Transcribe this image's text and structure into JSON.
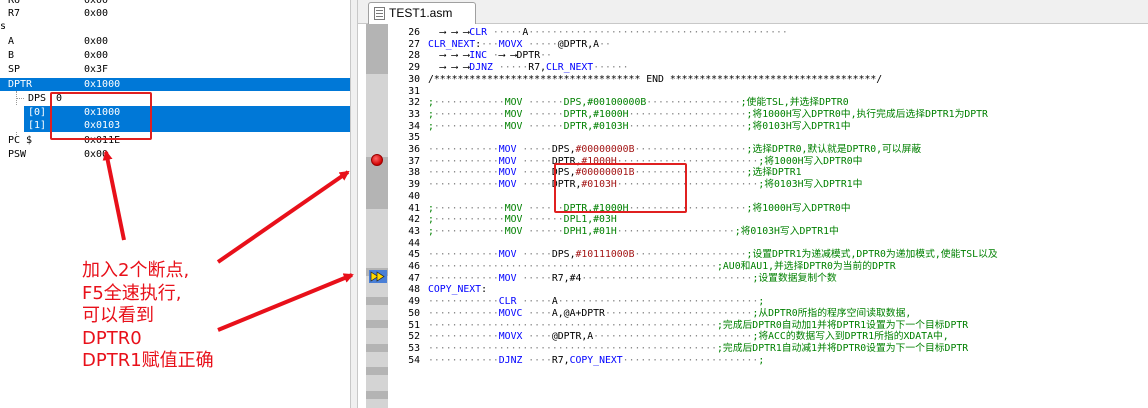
{
  "registers": [
    {
      "name": "R6",
      "value": "0x00"
    },
    {
      "name": "R7",
      "value": "0x00"
    },
    {
      "name": "s",
      "value": ""
    },
    {
      "name": "A",
      "value": "0x00"
    },
    {
      "name": "B",
      "value": "0x00"
    },
    {
      "name": "SP",
      "value": "0x3F"
    },
    {
      "name": "DPTR",
      "value": "0x1000"
    },
    {
      "name": "DPS",
      "value": "0"
    },
    {
      "name": "[0]",
      "value": "0x1000"
    },
    {
      "name": "[1]",
      "value": "0x0103"
    },
    {
      "name": "PC $",
      "value": "0x011E"
    },
    {
      "name": "PSW",
      "value": "0x00"
    }
  ],
  "editor": {
    "tab_title": "TEST1.asm",
    "lines": [
      {
        "n": "26",
        "code": "  ⟶ ⟶ ⟶CLR ·····A············································"
      },
      {
        "n": "27",
        "code": "CLR_NEXT:···MOVX ·····@DPTR,A··"
      },
      {
        "n": "28",
        "code": "  ⟶ ⟶ ⟶INC ·⟶ ⟶DPTR··"
      },
      {
        "n": "29",
        "code": "  ⟶ ⟶ ⟶DJNZ ·····R7,CLR_NEXT······"
      },
      {
        "n": "30",
        "code": "/*********************************** END ***********************************/"
      },
      {
        "n": "31",
        "code": ""
      },
      {
        "n": "32",
        "code": ";············MOV ······DPS,#00100000B················;使能TSL,并选择DPTR0"
      },
      {
        "n": "33",
        "code": ";············MOV ······DPTR,#1000H····················;将1000H写入DPTR0中,执行完成后选择DPTR1为DPTR"
      },
      {
        "n": "34",
        "code": ";············MOV ······DPTR,#0103H····················;将0103H写入DPTR1中"
      },
      {
        "n": "35",
        "code": ""
      },
      {
        "n": "36",
        "code": "············MOV ·····DPS,#00000000B···················;选择DPTR0,默认就是DPTR0,可以屏蔽"
      },
      {
        "n": "37",
        "code": "············MOV ·····DPTR,#1000H························;将1000H写入DPTR0中"
      },
      {
        "n": "38",
        "code": "············MOV ·····DPS,#00000001B···················;选择DPTR1"
      },
      {
        "n": "39",
        "code": "············MOV ·····DPTR,#0103H························;将0103H写入DPTR1中"
      },
      {
        "n": "40",
        "code": ""
      },
      {
        "n": "41",
        "code": ";············MOV ······DPTR,#1000H····················;将1000H写入DPTR0中"
      },
      {
        "n": "42",
        "code": ";············MOV ······DPL1,#03H"
      },
      {
        "n": "43",
        "code": ";············MOV ······DPH1,#01H····················;将0103H写入DPTR1中"
      },
      {
        "n": "44",
        "code": ""
      },
      {
        "n": "45",
        "code": "············MOV ·····DPS,#10111000B···················;设置DPTR1为递减模式,DPTR0为递加模式,使能TSL以及"
      },
      {
        "n": "46",
        "code": "·················································;AU0和AU1,并选择DPTR0为当前的DPTR"
      },
      {
        "n": "47",
        "code": "············MOV ·····R7,#4·····························;设置数据复制个数"
      },
      {
        "n": "48",
        "code": "COPY_NEXT:"
      },
      {
        "n": "49",
        "code": "············CLR ·····A··································;"
      },
      {
        "n": "50",
        "code": "············MOVC ····A,@A+DPTR·························;从DPTR0所指的程序空间读取数据,"
      },
      {
        "n": "51",
        "code": "·················································;完成后DPTR0自动加1并将DPTR1设置为下一个目标DPTR"
      },
      {
        "n": "52",
        "code": "············MOVX ····@DPTR,A···························;将ACC的数据写入到DPTR1所指的XDATA中,"
      },
      {
        "n": "53",
        "code": "·················································;完成后DPTR1自动减1并将DPTR0设置为下一个目标DPTR"
      },
      {
        "n": "54",
        "code": "············DJNZ ····R7,COPY_NEXT·······················;"
      }
    ]
  },
  "annotation": {
    "lines": [
      "加入2个断点,",
      "F5全速执行,",
      "可以看到",
      "DPTR0",
      "DPTR1赋值正确"
    ]
  }
}
